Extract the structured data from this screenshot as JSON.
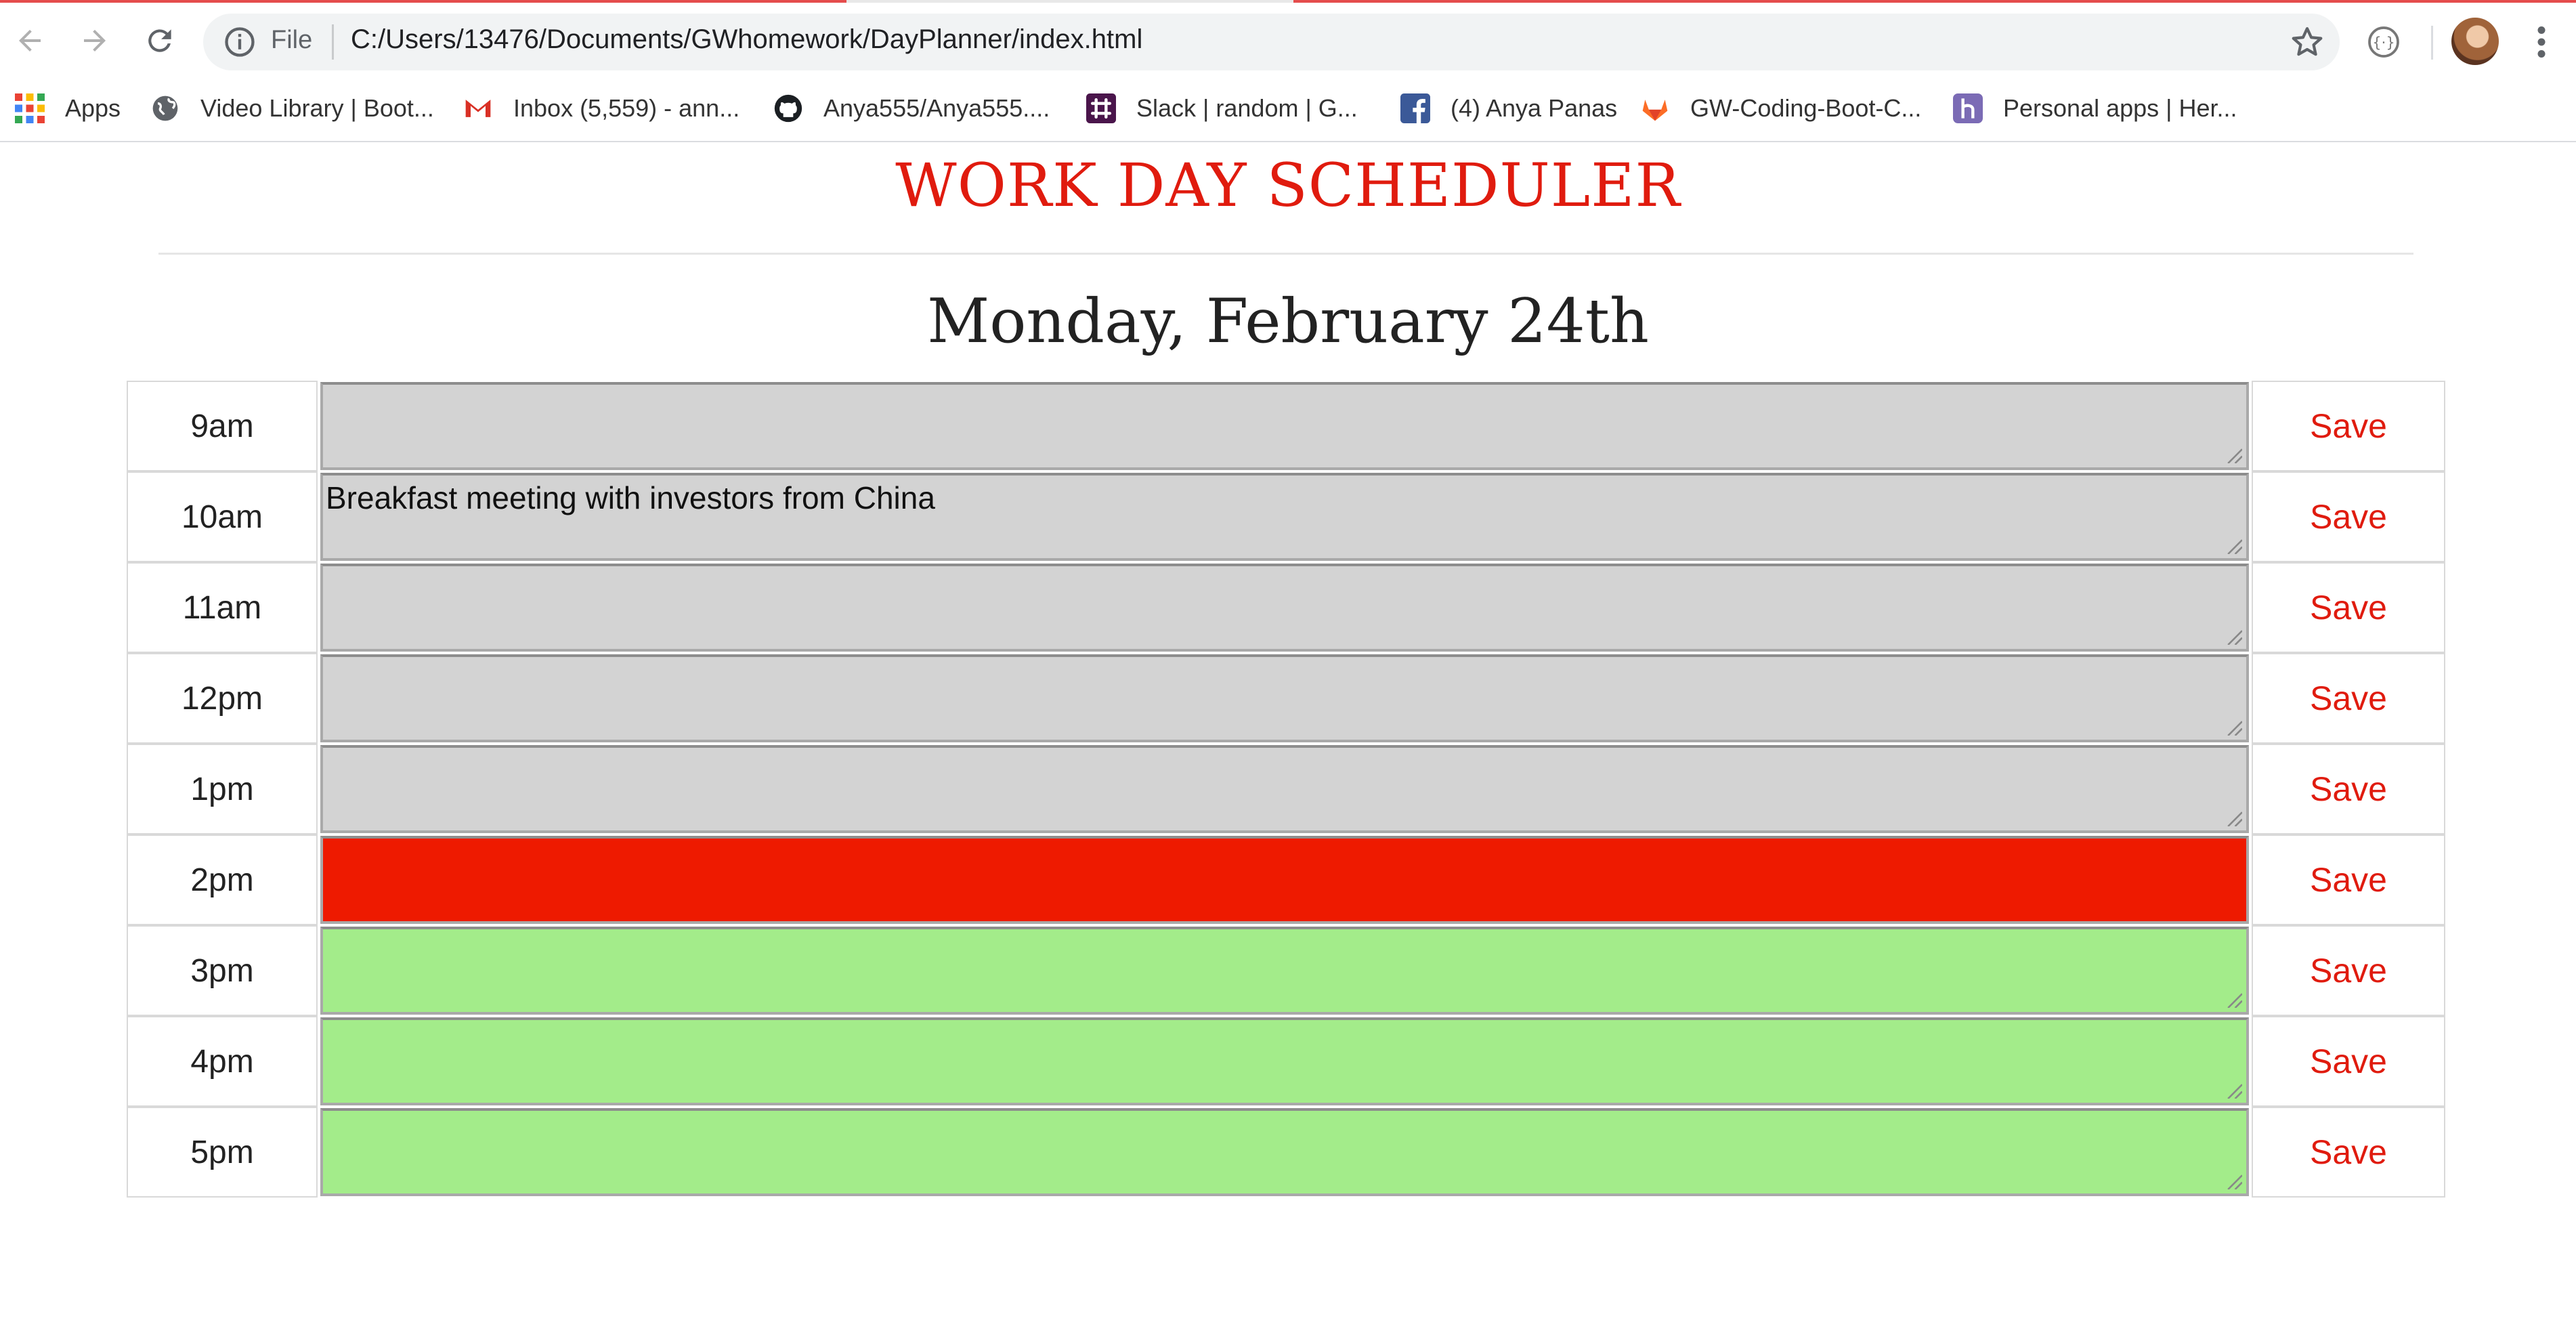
{
  "browser": {
    "file_label": "File",
    "url": "C:/Users/13476/Documents/GWhomework/DayPlanner/index.html",
    "icons": [
      "back-icon",
      "forward-icon",
      "reload-icon",
      "info-icon",
      "star-icon",
      "extension-icon",
      "profile-avatar",
      "menu-icon"
    ]
  },
  "bookmarks": [
    {
      "label": "Apps",
      "icon": "apps-grid-icon"
    },
    {
      "label": "Video Library | Boot...",
      "icon": "globe-icon"
    },
    {
      "label": "Inbox (5,559) - ann...",
      "icon": "gmail-icon"
    },
    {
      "label": "Anya555/Anya555....",
      "icon": "github-icon"
    },
    {
      "label": "Slack | random | G...",
      "icon": "slack-icon"
    },
    {
      "label": "(4) Anya Panas",
      "icon": "facebook-icon"
    },
    {
      "label": "GW-Coding-Boot-C...",
      "icon": "gitlab-icon"
    },
    {
      "label": "Personal apps | Her...",
      "icon": "heroku-icon"
    }
  ],
  "page": {
    "title": "WORK DAY SCHEDULER",
    "date": "Monday, February 24th",
    "save_label": "Save",
    "colors": {
      "title": "#e01b0e",
      "past": "#d3d3d3",
      "present": "#ee1a00",
      "future": "#a3ec8a"
    },
    "rows": [
      {
        "hour": "9am",
        "text": "",
        "state": "past"
      },
      {
        "hour": "10am",
        "text": "Breakfast meeting with investors from China",
        "state": "past"
      },
      {
        "hour": "11am",
        "text": "",
        "state": "past"
      },
      {
        "hour": "12pm",
        "text": "",
        "state": "past"
      },
      {
        "hour": "1pm",
        "text": "",
        "state": "past"
      },
      {
        "hour": "2pm",
        "text": "",
        "state": "present"
      },
      {
        "hour": "3pm",
        "text": "",
        "state": "future"
      },
      {
        "hour": "4pm",
        "text": "",
        "state": "future"
      },
      {
        "hour": "5pm",
        "text": "",
        "state": "future"
      }
    ]
  }
}
